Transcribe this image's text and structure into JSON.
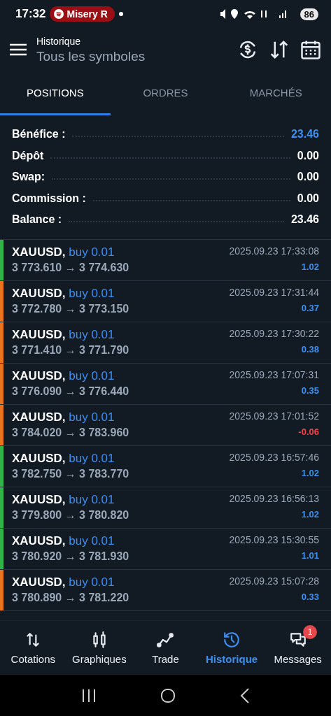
{
  "status_bar": {
    "time": "17:32",
    "media_pill": "Misery R",
    "battery": "86"
  },
  "header": {
    "title": "Historique",
    "subtitle": "Tous les symboles"
  },
  "tabs": [
    {
      "label": "POSITIONS",
      "selected": true
    },
    {
      "label": "ORDRES",
      "selected": false
    },
    {
      "label": "MARCHÉS",
      "selected": false
    }
  ],
  "summary": [
    {
      "label": "Bénéfice :",
      "value": "23.46",
      "highlight": true
    },
    {
      "label": "Dépôt",
      "value": "0.00",
      "highlight": false
    },
    {
      "label": "Swap:",
      "value": "0.00",
      "highlight": false
    },
    {
      "label": "Commission :",
      "value": "0.00",
      "highlight": false
    },
    {
      "label": "Balance :",
      "value": "23.46",
      "highlight": false
    }
  ],
  "deals": [
    {
      "symbol": "XAUUSD,",
      "side": "buy 0.01",
      "prices": "3 773.610 → 3 774.630",
      "time": "2025.09.23 17:33:08",
      "profit": "1.02",
      "loss": false,
      "color": "#2fb34a"
    },
    {
      "symbol": "XAUUSD,",
      "side": "buy 0.01",
      "prices": "3 772.780 → 3 773.150",
      "time": "2025.09.23 17:31:44",
      "profit": "0.37",
      "loss": false,
      "color": "#e8731c"
    },
    {
      "symbol": "XAUUSD,",
      "side": "buy 0.01",
      "prices": "3 771.410 → 3 771.790",
      "time": "2025.09.23 17:30:22",
      "profit": "0.38",
      "loss": false,
      "color": "#e8731c"
    },
    {
      "symbol": "XAUUSD,",
      "side": "buy 0.01",
      "prices": "3 776.090 → 3 776.440",
      "time": "2025.09.23 17:07:31",
      "profit": "0.35",
      "loss": false,
      "color": "#e8731c"
    },
    {
      "symbol": "XAUUSD,",
      "side": "buy 0.01",
      "prices": "3 784.020 → 3 783.960",
      "time": "2025.09.23 17:01:52",
      "profit": "-0.06",
      "loss": true,
      "color": "#e8731c"
    },
    {
      "symbol": "XAUUSD,",
      "side": "buy 0.01",
      "prices": "3 782.750 → 3 783.770",
      "time": "2025.09.23 16:57:46",
      "profit": "1.02",
      "loss": false,
      "color": "#2fb34a"
    },
    {
      "symbol": "XAUUSD,",
      "side": "buy 0.01",
      "prices": "3 779.800 → 3 780.820",
      "time": "2025.09.23 16:56:13",
      "profit": "1.02",
      "loss": false,
      "color": "#2fb34a"
    },
    {
      "symbol": "XAUUSD,",
      "side": "buy 0.01",
      "prices": "3 780.920 → 3 781.930",
      "time": "2025.09.23 15:30:55",
      "profit": "1.01",
      "loss": false,
      "color": "#2fb34a"
    },
    {
      "symbol": "XAUUSD,",
      "side": "buy 0.01",
      "prices": "3 780.890 → 3 781.220",
      "time": "2025.09.23 15:07:28",
      "profit": "0.33",
      "loss": false,
      "color": "#e8731c"
    }
  ],
  "bottom_nav": [
    {
      "kind": "quotes",
      "label": "Cotations",
      "selected": false
    },
    {
      "kind": "charts",
      "label": "Graphiques",
      "selected": false
    },
    {
      "kind": "trade",
      "label": "Trade",
      "selected": false
    },
    {
      "kind": "history",
      "label": "Historique",
      "selected": true
    },
    {
      "kind": "messages",
      "label": "Messages",
      "selected": false,
      "badge": "1"
    }
  ]
}
